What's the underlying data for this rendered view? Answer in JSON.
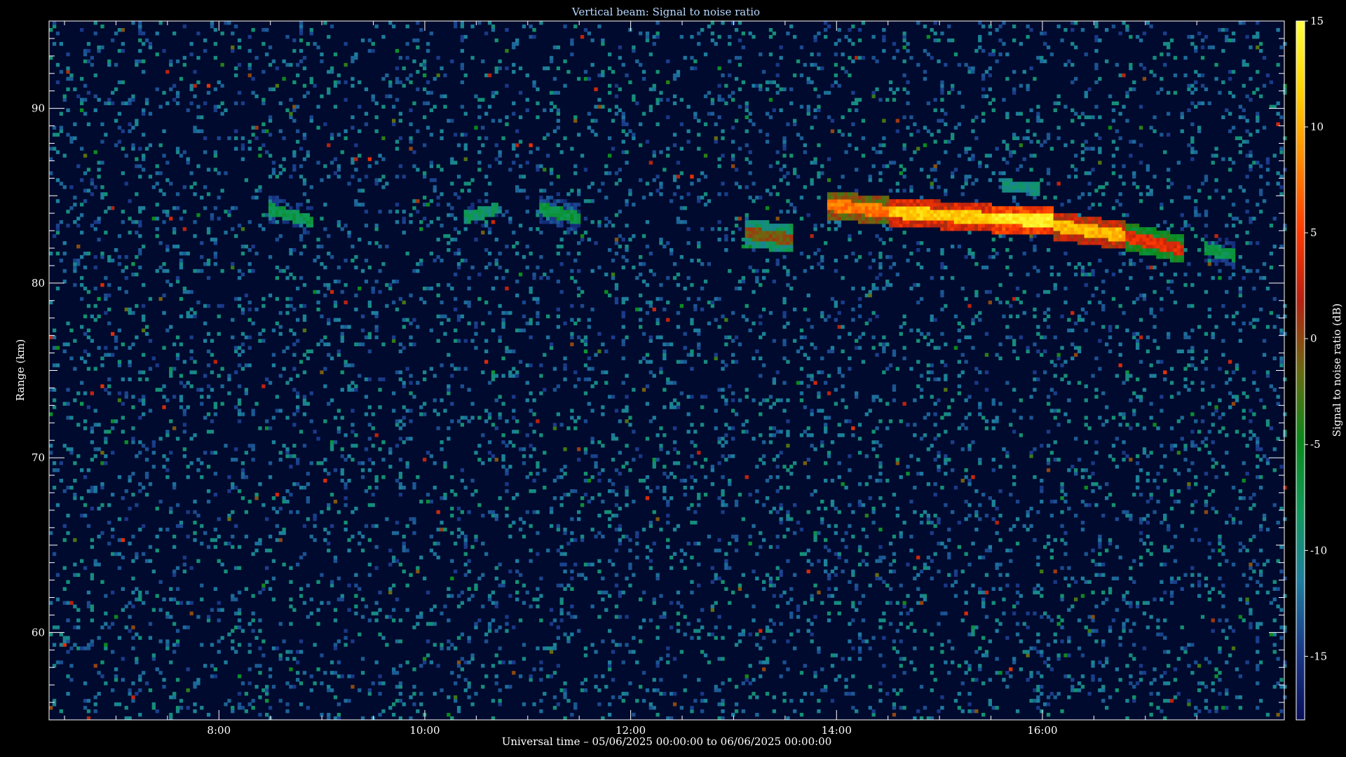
{
  "chart_data": {
    "type": "heatmap",
    "title": "Vertical beam: Signal to noise ratio",
    "xlabel": "Universal time – 05/06/2025 00:00:00 to 06/06/2025 00:00:00",
    "ylabel": "Range (km)",
    "colorbar_label": "Signal to noise ratio (dB)",
    "xlim_hours": [
      6.35,
      18.35
    ],
    "ylim": [
      55,
      95
    ],
    "x_ticks": [
      {
        "hour": 8,
        "label": "8:00"
      },
      {
        "hour": 10,
        "label": "10:00"
      },
      {
        "hour": 12,
        "label": "12:00"
      },
      {
        "hour": 14,
        "label": "14:00"
      },
      {
        "hour": 16,
        "label": "16:00"
      }
    ],
    "y_ticks": [
      60,
      70,
      80,
      90
    ],
    "colorbar_ticks": [
      -15,
      -10,
      -5,
      0,
      5,
      10,
      15
    ],
    "colorbar_range": [
      -18,
      15
    ],
    "background_snr": -18,
    "layers": [
      {
        "t_start": 8.45,
        "t_end": 8.9,
        "h_start": 84.2,
        "h_end": 83.4,
        "snr": -6
      },
      {
        "t_start": 10.35,
        "t_end": 10.7,
        "h_start": 83.6,
        "h_end": 84.2,
        "snr": -7
      },
      {
        "t_start": 11.1,
        "t_end": 11.5,
        "h_start": 84.2,
        "h_end": 83.6,
        "snr": -5
      },
      {
        "t_start": 13.1,
        "t_end": 13.55,
        "h_start": 82.8,
        "h_end": 82.4,
        "snr": 1
      },
      {
        "t_start": 13.9,
        "t_end": 14.5,
        "h_start": 84.4,
        "h_end": 84.0,
        "snr": 9
      },
      {
        "t_start": 14.5,
        "t_end": 15.5,
        "h_start": 84.0,
        "h_end": 83.6,
        "snr": 13
      },
      {
        "t_start": 15.5,
        "t_end": 16.1,
        "h_start": 83.6,
        "h_end": 83.5,
        "snr": 15
      },
      {
        "t_start": 16.1,
        "t_end": 16.8,
        "h_start": 83.2,
        "h_end": 82.6,
        "snr": 12
      },
      {
        "t_start": 16.8,
        "t_end": 17.35,
        "h_start": 82.6,
        "h_end": 81.8,
        "snr": 5
      },
      {
        "t_start": 17.55,
        "t_end": 17.85,
        "h_start": 81.9,
        "h_end": 81.5,
        "snr": -6
      },
      {
        "t_start": 15.6,
        "t_end": 15.95,
        "h_start": 85.5,
        "h_end": 85.3,
        "snr": -8
      }
    ],
    "colormap": [
      "#0a0f5a",
      "#1a3a8a",
      "#1d7fa0",
      "#0f9a5a",
      "#0a8a1a",
      "#6a6a10",
      "#b82010",
      "#ff3a00",
      "#ff8a00",
      "#ffd200",
      "#ffff40"
    ]
  }
}
